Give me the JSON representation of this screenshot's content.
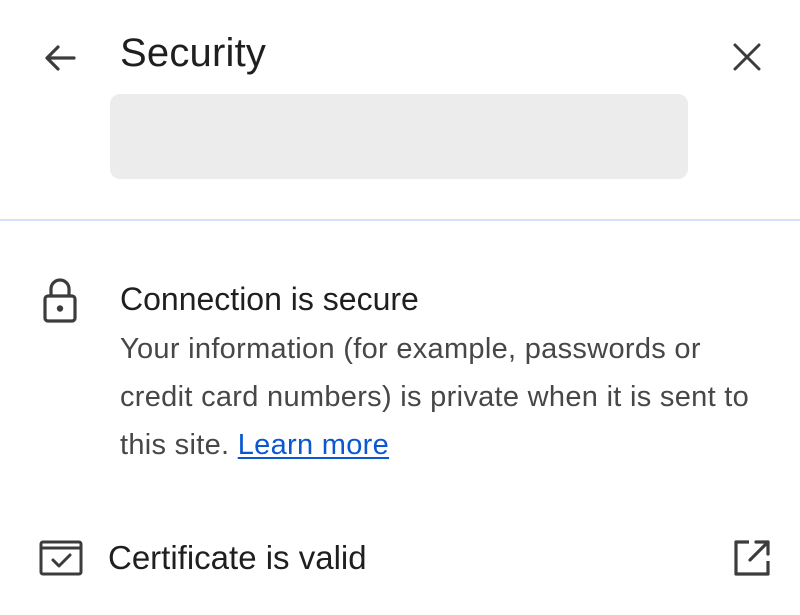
{
  "header": {
    "title": "Security",
    "back_icon": "arrow-back-icon",
    "close_icon": "close-icon"
  },
  "connection": {
    "icon": "lock-icon",
    "title": "Connection is secure",
    "description": "Your information (for example, passwords or credit card numbers) is private when it is sent to this site.",
    "learn_more": "Learn more"
  },
  "certificate": {
    "icon": "certificate-icon",
    "label": "Certificate is valid",
    "action_icon": "open-external-icon"
  },
  "colors": {
    "text_primary": "#1f1f1f",
    "text_secondary": "#474747",
    "link": "#0b57d0",
    "divider": "#d3e3fd",
    "chip_background": "#ececec"
  }
}
